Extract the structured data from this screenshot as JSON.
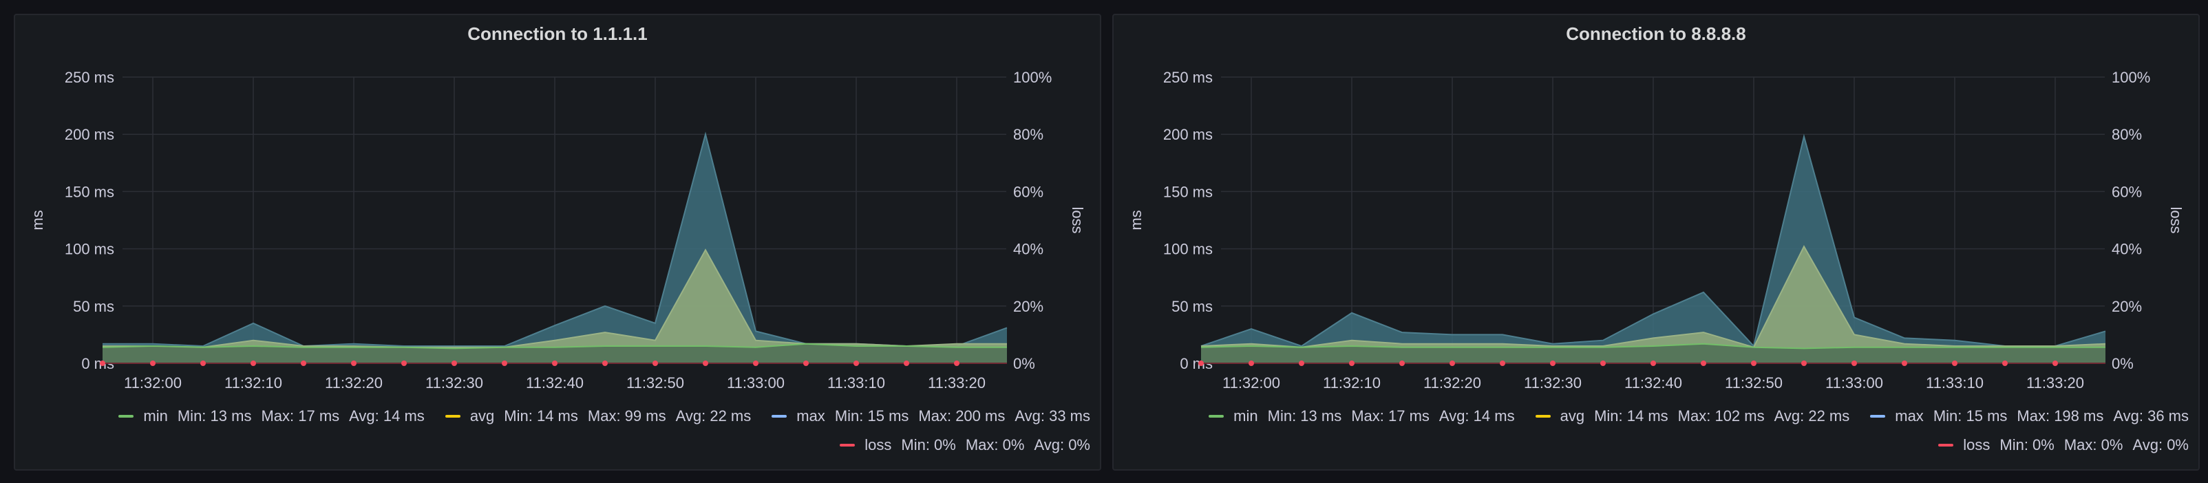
{
  "colors": {
    "background": "#111217",
    "panel": "#181b1f",
    "grid": "#2c2f36",
    "min": "#73bf69",
    "avg": "#f2cc0c",
    "max": "#8ab8ff",
    "loss": "#f2495c"
  },
  "chart_data": [
    {
      "type": "area",
      "title": "Connection to 1.1.1.1",
      "ylabel": "ms",
      "y2label": "loss",
      "ylim": [
        0,
        250
      ],
      "y_ticks": [
        "0 ms",
        "50 ms",
        "100 ms",
        "150 ms",
        "200 ms",
        "250 ms"
      ],
      "y2lim": [
        0,
        100
      ],
      "y2_ticks": [
        "0%",
        "20%",
        "40%",
        "60%",
        "80%",
        "100%"
      ],
      "x_ticks": [
        "11:32:00",
        "11:32:10",
        "11:32:20",
        "11:32:30",
        "11:32:40",
        "11:32:50",
        "11:33:00",
        "11:33:10",
        "11:33:20"
      ],
      "x_seconds": [
        -5,
        0,
        5,
        10,
        15,
        20,
        25,
        30,
        35,
        40,
        45,
        50,
        55,
        60,
        65,
        70,
        75,
        80,
        85
      ],
      "loss_points_seconds": [
        -5,
        0,
        5,
        10,
        15,
        20,
        25,
        30,
        35,
        40,
        45,
        50,
        55,
        60,
        65,
        70,
        75,
        80
      ],
      "grid": true,
      "legend_position": "bottom-right",
      "series": [
        {
          "name": "min",
          "axis": "left",
          "values": [
            14,
            15,
            14,
            15,
            14,
            14,
            14,
            13,
            14,
            14,
            15,
            15,
            15,
            14,
            17,
            15,
            15,
            14,
            14
          ]
        },
        {
          "name": "avg",
          "axis": "left",
          "values": [
            15,
            15,
            14,
            20,
            15,
            15,
            14,
            14,
            14,
            20,
            27,
            20,
            99,
            20,
            17,
            17,
            15,
            17,
            17
          ]
        },
        {
          "name": "max",
          "axis": "left",
          "values": [
            17,
            17,
            15,
            35,
            15,
            17,
            15,
            15,
            15,
            33,
            50,
            35,
            200,
            28,
            17,
            17,
            15,
            15,
            31
          ]
        },
        {
          "name": "loss",
          "axis": "right",
          "values": [
            0,
            0,
            0,
            0,
            0,
            0,
            0,
            0,
            0,
            0,
            0,
            0,
            0,
            0,
            0,
            0,
            0,
            0
          ]
        }
      ],
      "legend": {
        "row1": [
          {
            "name": "min",
            "stats": [
              "Min: 13 ms",
              "Max: 17 ms",
              "Avg: 14 ms"
            ]
          },
          {
            "name": "avg",
            "stats": [
              "Min: 14 ms",
              "Max: 99 ms",
              "Avg: 22 ms"
            ]
          },
          {
            "name": "max",
            "stats": [
              "Min: 15 ms",
              "Max: 200 ms",
              "Avg: 33 ms"
            ]
          }
        ],
        "row2": [
          {
            "name": "loss",
            "stats": [
              "Min: 0%",
              "Max: 0%",
              "Avg: 0%"
            ]
          }
        ]
      }
    },
    {
      "type": "area",
      "title": "Connection to 8.8.8.8",
      "ylabel": "ms",
      "y2label": "loss",
      "ylim": [
        0,
        250
      ],
      "y_ticks": [
        "0 ms",
        "50 ms",
        "100 ms",
        "150 ms",
        "200 ms",
        "250 ms"
      ],
      "y2lim": [
        0,
        100
      ],
      "y2_ticks": [
        "0%",
        "20%",
        "40%",
        "60%",
        "80%",
        "100%"
      ],
      "x_ticks": [
        "11:32:00",
        "11:32:10",
        "11:32:20",
        "11:32:30",
        "11:32:40",
        "11:32:50",
        "11:33:00",
        "11:33:10",
        "11:33:20"
      ],
      "x_seconds": [
        -5,
        0,
        5,
        10,
        15,
        20,
        25,
        30,
        35,
        40,
        45,
        50,
        55,
        60,
        65,
        70,
        75,
        80,
        85
      ],
      "loss_points_seconds": [
        -5,
        0,
        5,
        10,
        15,
        20,
        25,
        30,
        35,
        40,
        45,
        50,
        55,
        60,
        65,
        70,
        75,
        80
      ],
      "grid": true,
      "legend_position": "bottom-right",
      "series": [
        {
          "name": "min",
          "axis": "left",
          "values": [
            14,
            15,
            14,
            15,
            14,
            14,
            14,
            14,
            14,
            15,
            17,
            14,
            13,
            14,
            14,
            14,
            14,
            14,
            14
          ]
        },
        {
          "name": "avg",
          "axis": "left",
          "values": [
            15,
            17,
            14,
            20,
            17,
            17,
            17,
            15,
            15,
            22,
            27,
            14,
            102,
            25,
            17,
            15,
            15,
            15,
            17
          ]
        },
        {
          "name": "max",
          "axis": "left",
          "values": [
            15,
            30,
            15,
            44,
            27,
            25,
            25,
            17,
            20,
            43,
            62,
            15,
            198,
            40,
            22,
            20,
            15,
            15,
            28
          ]
        },
        {
          "name": "loss",
          "axis": "right",
          "values": [
            0,
            0,
            0,
            0,
            0,
            0,
            0,
            0,
            0,
            0,
            0,
            0,
            0,
            0,
            0,
            0,
            0,
            0
          ]
        }
      ],
      "legend": {
        "row1": [
          {
            "name": "min",
            "stats": [
              "Min: 13 ms",
              "Max: 17 ms",
              "Avg: 14 ms"
            ]
          },
          {
            "name": "avg",
            "stats": [
              "Min: 14 ms",
              "Max: 102 ms",
              "Avg: 22 ms"
            ]
          },
          {
            "name": "max",
            "stats": [
              "Min: 15 ms",
              "Max: 198 ms",
              "Avg: 36 ms"
            ]
          }
        ],
        "row2": [
          {
            "name": "loss",
            "stats": [
              "Min: 0%",
              "Max: 0%",
              "Avg: 0%"
            ]
          }
        ]
      }
    }
  ]
}
